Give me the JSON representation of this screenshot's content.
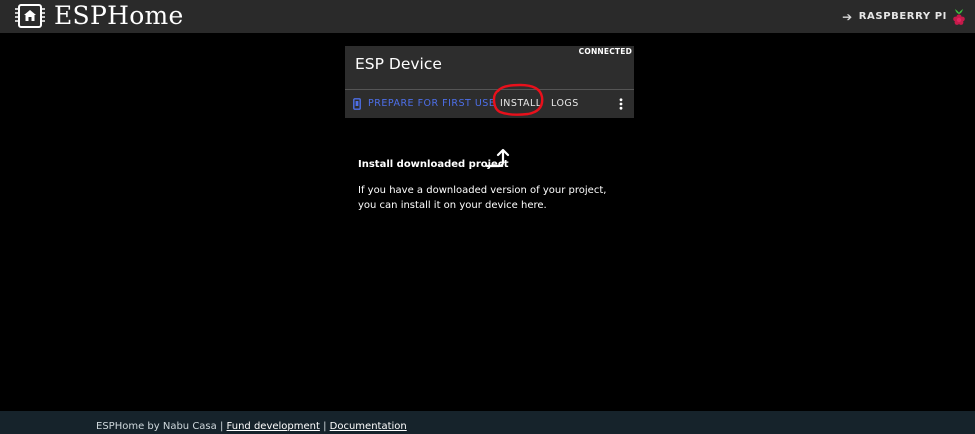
{
  "header": {
    "brand": "ESPHome",
    "platform_label": "RASPBERRY PI",
    "logo_icon": "esphome-chip-icon",
    "platform_icon": "raspberry-pi-icon"
  },
  "device_card": {
    "status": "CONNECTED",
    "title": "ESP Device",
    "actions": {
      "prepare": "PREPARE FOR FIRST USE",
      "install": "INSTALL",
      "logs": "LOGS"
    },
    "highlight_color": "#e8101b",
    "prepare_color": "#4d6fe8"
  },
  "install_info": {
    "title": "Install downloaded project",
    "description": "If you have a downloaded version of your project, you can install it on your device here."
  },
  "footer": {
    "prefix": "ESPHome by Nabu Casa",
    "separator": "|",
    "links": {
      "fund": "Fund development",
      "docs": "Documentation"
    }
  },
  "colors": {
    "header_bg": "#2a2a2a",
    "card_bg": "#2d2d2d",
    "footer_bg": "#16232b",
    "page_bg": "#000000"
  }
}
